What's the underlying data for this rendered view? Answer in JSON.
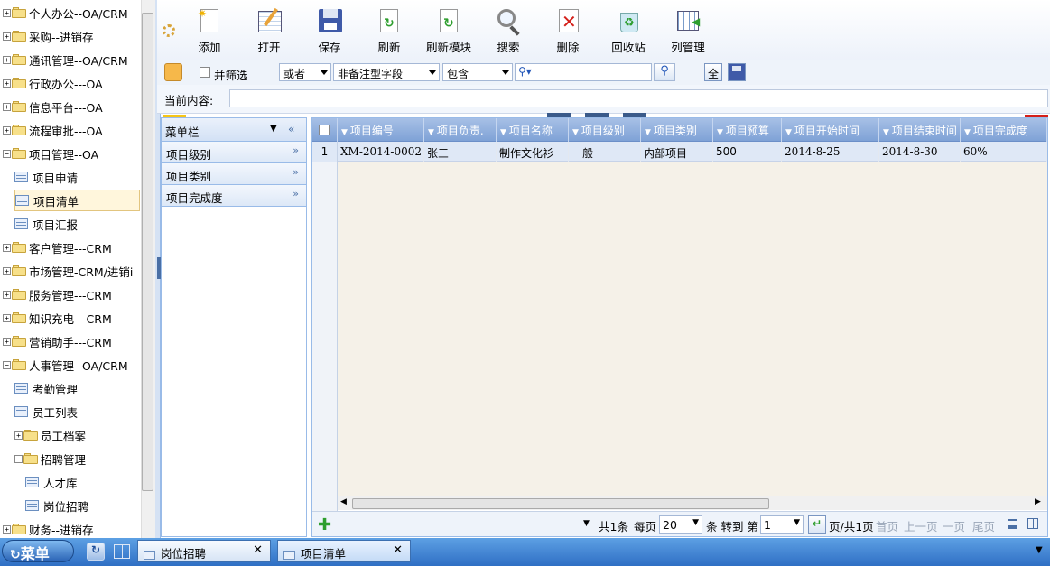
{
  "tree": {
    "items": [
      {
        "label": "个人办公--OA/CRM",
        "kind": "folder"
      },
      {
        "label": "采购--进销存",
        "kind": "folder"
      },
      {
        "label": "通讯管理--OA/CRM",
        "kind": "folder"
      },
      {
        "label": "行政办公---OA",
        "kind": "folder"
      },
      {
        "label": "信息平台---OA",
        "kind": "folder"
      },
      {
        "label": "流程审批---OA",
        "kind": "folder"
      },
      {
        "label": "项目管理--OA",
        "kind": "folder-open"
      },
      {
        "label": "项目申请",
        "kind": "leaf"
      },
      {
        "label": "项目清单",
        "kind": "leaf-selected"
      },
      {
        "label": "项目汇报",
        "kind": "leaf"
      },
      {
        "label": "客户管理---CRM",
        "kind": "folder"
      },
      {
        "label": "市场管理-CRM/进销i",
        "kind": "folder"
      },
      {
        "label": "服务管理---CRM",
        "kind": "folder"
      },
      {
        "label": "知识充电---CRM",
        "kind": "folder"
      },
      {
        "label": "营销助手---CRM",
        "kind": "folder"
      },
      {
        "label": "人事管理--OA/CRM",
        "kind": "folder-open"
      },
      {
        "label": "考勤管理",
        "kind": "leaf"
      },
      {
        "label": "员工列表",
        "kind": "leaf"
      },
      {
        "label": "员工档案",
        "kind": "folder-sub"
      },
      {
        "label": "招聘管理",
        "kind": "folder-sub-open"
      },
      {
        "label": "人才库",
        "kind": "leaf-sub"
      },
      {
        "label": "岗位招聘",
        "kind": "leaf-sub"
      },
      {
        "label": "财务--进销存",
        "kind": "folder"
      }
    ]
  },
  "toolbar": {
    "buttons": [
      "添加",
      "打开",
      "保存",
      "刷新",
      "刷新模块",
      "搜索",
      "删除",
      "回收站",
      "列管理"
    ]
  },
  "filter": {
    "checkbox_label": "并筛选",
    "logic": "或者",
    "field": "非备注型字段",
    "op": "包含",
    "value": "",
    "all_button": "全"
  },
  "current": {
    "label": "当前内容:",
    "value": ""
  },
  "menu": {
    "header": "菜单栏",
    "items": [
      "项目级别",
      "项目类别",
      "项目完成度"
    ]
  },
  "grid": {
    "columns": [
      "项目编号",
      "项目负责.",
      "项目名称",
      "项目级别",
      "项目类别",
      "项目预算",
      "项目开始时间",
      "项目结束时间",
      "项目完成度"
    ],
    "rows": [
      {
        "num": "1",
        "cells": [
          "XM-2014-0002",
          "张三",
          "制作文化衫",
          "一般",
          "内部项目",
          "500",
          "2014-8-25",
          "2014-8-30",
          "60%"
        ]
      }
    ]
  },
  "pager": {
    "total": "共1条",
    "per_page_label": "每页",
    "per_page": "20",
    "goto_label": "条 转到 第",
    "page": "1",
    "page_info": "页/共1页",
    "first": "首页",
    "prev": "上一页",
    "next": "一页",
    "last": "尾页"
  },
  "taskbar": {
    "start": "菜单",
    "tabs": [
      "岗位招聘",
      "项目清单"
    ]
  },
  "colors": {
    "accent": "#2f6fc4",
    "header": "#7fa2d6",
    "selected": "#fff6dc"
  }
}
